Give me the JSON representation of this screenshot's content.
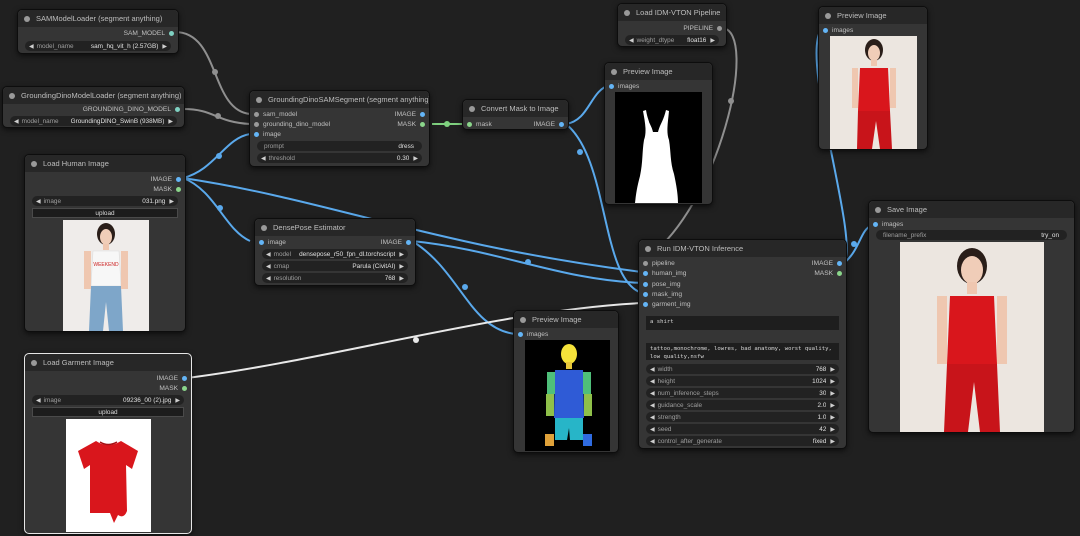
{
  "colors": {
    "canvas": "#202020",
    "node_body": "#353535",
    "node_title": "#272727",
    "image_wire": "#64b5f6",
    "mask_wire": "#8bd68b",
    "model_wire": "#9a9a9a",
    "garment_red": "#d9161c"
  },
  "sam_loader": {
    "title": "SAMModelLoader (segment anything)",
    "out_label": "SAM_MODEL",
    "model_name_label": "model_name",
    "model_name_value": "sam_hq_vit_h (2.57GB)"
  },
  "grounding_loader": {
    "title": "GroundingDinoModelLoader (segment anything)",
    "out_label": "GROUNDING_DINO_MODEL",
    "model_name_label": "model_name",
    "model_name_value": "GroundingDINO_SwinB (938MB)"
  },
  "segment": {
    "title": "GroundingDinoSAMSegment (segment anything)",
    "inputs": [
      "sam_model",
      "grounding_dino_model",
      "image"
    ],
    "outputs": [
      "IMAGE",
      "MASK"
    ],
    "prompt_label": "prompt",
    "prompt_value": "dress",
    "threshold_label": "threshold",
    "threshold_value": "0.30"
  },
  "convert_mask": {
    "title": "Convert Mask to Image",
    "input": "mask",
    "output": "IMAGE"
  },
  "load_pipeline": {
    "title": "Load IDM-VTON Pipeline",
    "output": "PIPELINE",
    "weight_dtype_label": "weight_dtype",
    "weight_dtype_value": "float16"
  },
  "preview_mask": {
    "title": "Preview Image",
    "input": "images"
  },
  "preview_top": {
    "title": "Preview Image",
    "input": "images"
  },
  "preview_dense": {
    "title": "Preview Image",
    "input": "images"
  },
  "load_human": {
    "title": "Load Human Image",
    "outputs": [
      "IMAGE",
      "MASK"
    ],
    "image_label": "image",
    "image_value": "031.png",
    "upload_label": "upload"
  },
  "densepose": {
    "title": "DensePose Estimator",
    "input": "image",
    "output": "IMAGE",
    "model_label": "model",
    "model_value": "densepose_r50_fpn_dl.torchscript",
    "cmap_label": "cmap",
    "cmap_value": "Parula (CivitAI)",
    "resolution_label": "resolution",
    "resolution_value": "768"
  },
  "run_vton": {
    "title": "Run IDM-VTON Inference",
    "inputs": [
      "pipeline",
      "human_img",
      "pose_img",
      "mask_img",
      "garment_img"
    ],
    "outputs": [
      "IMAGE",
      "MASK"
    ],
    "garment_description": "a shirt",
    "negative_prompt": "tattoo,monochrome, lowres, bad anatomy, worst quality, low quality,nsfw",
    "params": [
      {
        "label": "width",
        "value": "768"
      },
      {
        "label": "height",
        "value": "1024"
      },
      {
        "label": "num_inference_steps",
        "value": "30"
      },
      {
        "label": "guidance_scale",
        "value": "2.0"
      },
      {
        "label": "strength",
        "value": "1.0"
      },
      {
        "label": "seed",
        "value": "42"
      },
      {
        "label": "control_after_generate",
        "value": "fixed"
      }
    ]
  },
  "load_garment": {
    "title": "Load Garment Image",
    "outputs": [
      "IMAGE",
      "MASK"
    ],
    "image_label": "image",
    "image_value": "09236_00 (2).jpg",
    "upload_label": "upload"
  },
  "save_image": {
    "title": "Save Image",
    "input": "images",
    "filename_prefix_label": "filename_prefix",
    "filename_prefix_value": "try_on"
  },
  "shirt_print_text": "WEEKEND"
}
